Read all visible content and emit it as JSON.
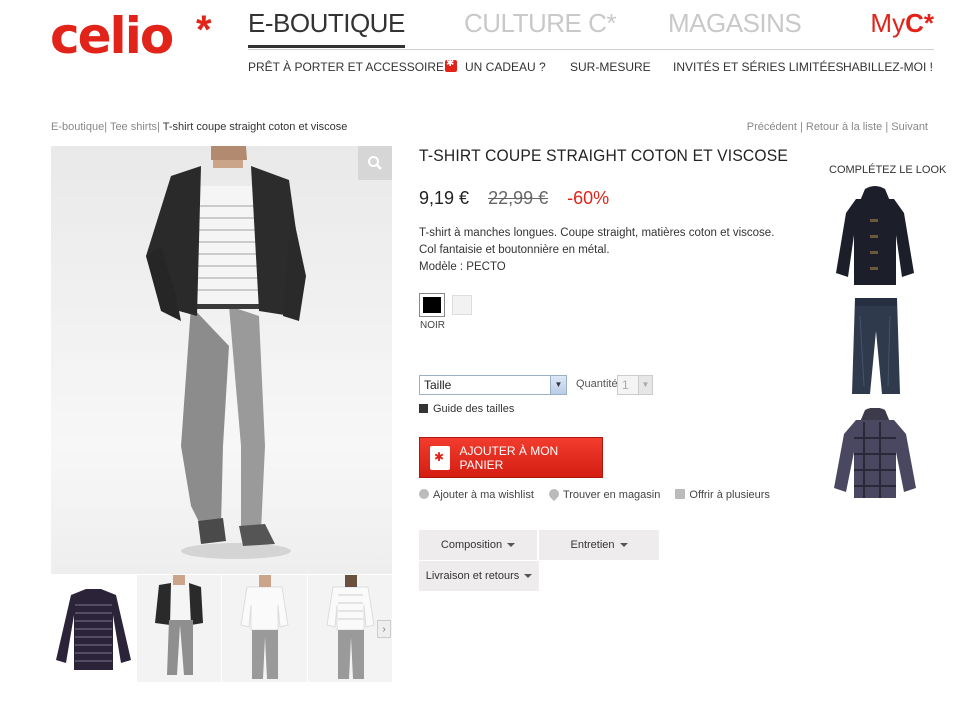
{
  "brand": {
    "logo_text": "celio",
    "logo_star": "*"
  },
  "topnav": {
    "items": [
      "E-BOUTIQUE",
      "CULTURE C*",
      "MAGASINS"
    ],
    "myc_prefix": "My",
    "myc_brand": "C*"
  },
  "subnav": {
    "items": [
      "PRÊT À PORTER ET ACCESSOIRES",
      "UN CADEAU ?",
      "SUR-MESURE",
      "INVITÉS ET SÉRIES LIMITÉES",
      "HABILLEZ-MOI !"
    ]
  },
  "breadcrumb": {
    "items": [
      "E-boutique",
      "Tee shirts",
      "T-shirt coupe straight coton et viscose"
    ],
    "separator": "|"
  },
  "pager": {
    "prev": "Précédent",
    "back": "Retour à la liste",
    "next": "Suivant"
  },
  "product": {
    "title": "T-SHIRT COUPE STRAIGHT COTON ET VISCOSE",
    "price_now": "9,19 €",
    "price_old": "22,99 €",
    "discount": "-60%",
    "description": "T-shirt à manches longues. Coupe straight, matières coton et viscose. Col fantaisie et boutonnière en métal.",
    "model": "Modèle : PECTO",
    "color_selected_label": "NOIR",
    "swatches": [
      {
        "name": "noir",
        "color": "#000000"
      },
      {
        "name": "blanc",
        "color": "#f2f2f2"
      }
    ]
  },
  "form": {
    "size_placeholder": "Taille",
    "quantity_label": "Quantité",
    "quantity_value": "1",
    "size_guide": "Guide des tailles",
    "add_to_cart": "AJOUTER À MON PANIER"
  },
  "actions": [
    "Ajouter à ma wishlist",
    "Trouver en magasin",
    "Offrir à plusieurs"
  ],
  "tabs": [
    "Composition",
    "Entretien",
    "Livraison et retours"
  ],
  "look": {
    "title": "COMPLÉTEZ LE LOOK"
  },
  "colors": {
    "brand_red": "#e2231a",
    "tab_bg": "#eeeced"
  }
}
